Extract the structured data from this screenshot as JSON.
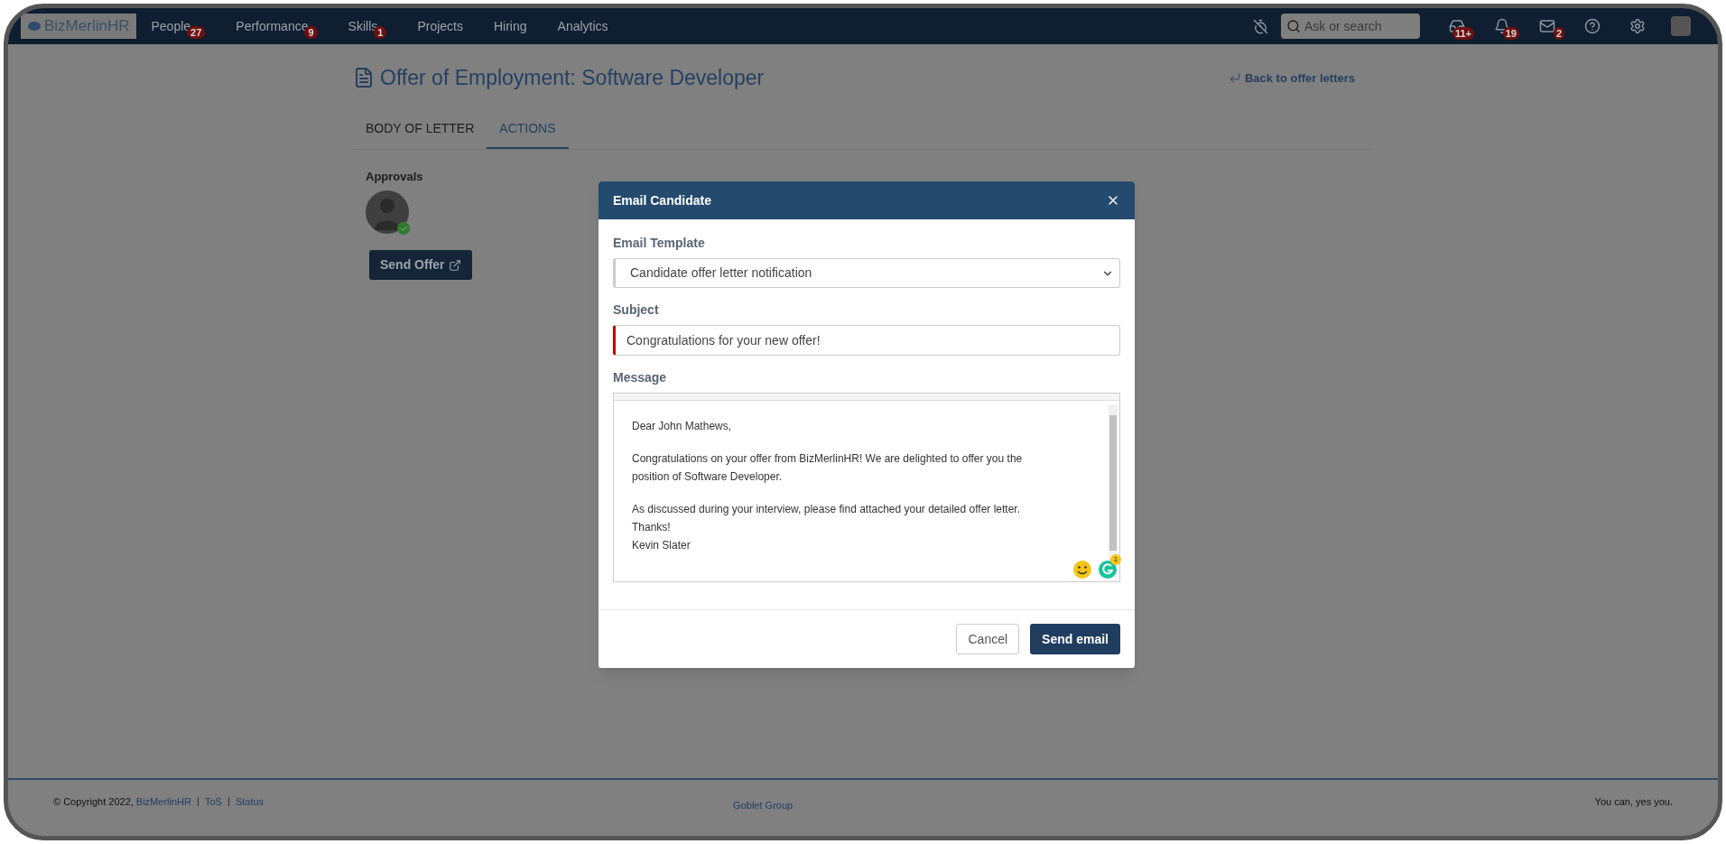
{
  "nav": {
    "logo": "BizMerlinHR",
    "items": [
      {
        "label": "People",
        "badge": "27"
      },
      {
        "label": "Performance",
        "badge": "9"
      },
      {
        "label": "Skills",
        "badge": "1"
      },
      {
        "label": "Projects"
      },
      {
        "label": "Hiring"
      },
      {
        "label": "Analytics"
      }
    ],
    "search": {
      "placeholder": "Ask or search"
    },
    "icons": [
      {
        "kind": "timer"
      },
      {
        "kind": "inbox",
        "badge": "11+"
      },
      {
        "kind": "bell",
        "badge": "19"
      },
      {
        "kind": "mail",
        "badge": "2"
      },
      {
        "kind": "help"
      },
      {
        "kind": "settings"
      }
    ]
  },
  "page": {
    "title": "Offer of Employment: Software Developer",
    "back_link": "Back to offer letters",
    "tabs": [
      {
        "label": "BODY OF LETTER",
        "selected": false
      },
      {
        "label": "ACTIONS",
        "selected": true
      }
    ],
    "approvals": {
      "label": "Approvals",
      "approved": true
    },
    "send_offer": "Send Offer"
  },
  "modal": {
    "title": "Email Candidate",
    "template": {
      "label": "Email Template",
      "value": "Candidate offer letter notification"
    },
    "subject": {
      "label": "Subject",
      "value": "Congratulations for your new offer!",
      "invalid": true
    },
    "message": {
      "label": "Message",
      "paragraphs": [
        [
          "Dear John Mathews,"
        ],
        [
          "Congratulations on your offer from BizMerlinHR! We are delighted to offer you the position of Software Developer."
        ],
        [
          "As discussed during your interview, please find attached your detailed offer letter.",
          "Thanks!",
          "Kevin Slater"
        ]
      ],
      "grammar_badge": "1"
    },
    "buttons": {
      "cancel": "Cancel",
      "send": "Send email"
    }
  },
  "footer": {
    "copyright": "© Copyright 2022,",
    "company": "BizMerlinHR",
    "links": [
      "ToS",
      "Status"
    ],
    "center": "Goblet Group",
    "tagline": "You can, yes you."
  }
}
